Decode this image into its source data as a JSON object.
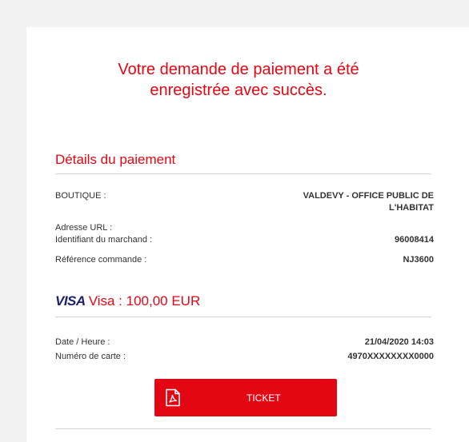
{
  "message": {
    "line1": "Votre demande de paiement a été",
    "line2": "enregistrée avec succès."
  },
  "payment_details": {
    "title": "Détails du paiement",
    "shop_label": "BOUTIQUE :",
    "shop_value_line1": "VALDEVY - OFFICE PUBLIC DE",
    "shop_value_line2": "L'HABITAT",
    "url_label": "Adresse URL :",
    "merchant_id_label": "Identifiant du marchand :",
    "merchant_id_value": "96008414",
    "order_ref_label": "Référence commande :",
    "order_ref_value": "NJ3600"
  },
  "card": {
    "logo_text": "VISA",
    "summary": "Visa : 100,00 EUR",
    "datetime_label": "Date / Heure :",
    "datetime_value": "21/04/2020 14:03",
    "card_number_label": "Numéro de carte :",
    "card_number_value": "4970XXXXXXXX0000"
  },
  "ticket_button": {
    "label": "TICKET",
    "icon": "pdf-icon"
  },
  "colors": {
    "accent": "#e30613",
    "visa_blue": "#1a1f71",
    "background": "#f2f2f2",
    "card": "#ffffff"
  }
}
